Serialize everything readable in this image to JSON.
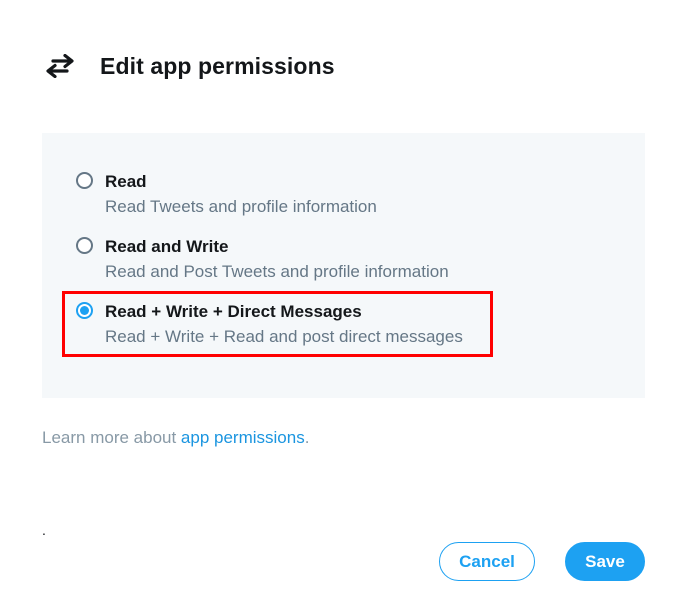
{
  "header": {
    "icon": "swap-arrows-icon",
    "title": "Edit app permissions"
  },
  "permissions": {
    "options": [
      {
        "label": "Read",
        "description": "Read Tweets and profile information",
        "selected": false
      },
      {
        "label": "Read and Write",
        "description": "Read and Post Tweets and profile information",
        "selected": false
      },
      {
        "label": "Read + Write + Direct Messages",
        "description": "Read + Write + Read and post direct messages",
        "selected": true
      }
    ]
  },
  "learn_more": {
    "prefix": "Learn more about ",
    "link_text": "app permissions",
    "suffix": "."
  },
  "stray_mark": ".",
  "actions": {
    "cancel_label": "Cancel",
    "save_label": "Save"
  },
  "colors": {
    "accent": "#1da1f2",
    "highlight_border": "#ff0000",
    "panel_background": "#f5f8fa",
    "secondary_text": "#657786"
  }
}
